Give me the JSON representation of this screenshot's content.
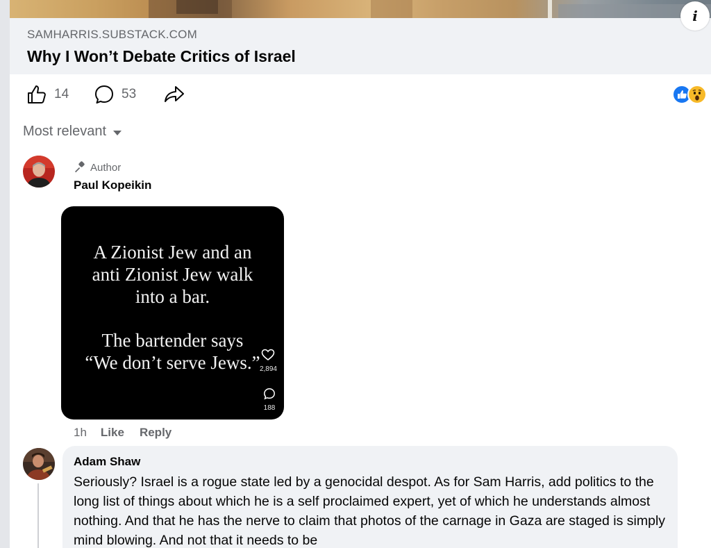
{
  "link_preview": {
    "domain": "SAMHARRIS.SUBSTACK.COM",
    "title": "Why I Won’t Debate Critics of Israel"
  },
  "post_actions": {
    "likes_count": "14",
    "comments_count": "53"
  },
  "reactions": [
    "like",
    "wow"
  ],
  "comments_sort": {
    "label": "Most relevant"
  },
  "comments": [
    {
      "badge": "Author",
      "name": "Paul Kopeikin",
      "meme": {
        "lines_top": [
          "A Zionist Jew and an",
          "anti Zionist Jew walk",
          "into a bar."
        ],
        "lines_bottom": [
          "The bartender says",
          "“We don’t serve Jews.”"
        ],
        "like_count": "2,894",
        "comment_count": "188"
      },
      "time": "1h",
      "like_label": "Like",
      "reply_label": "Reply"
    },
    {
      "name": "Adam Shaw",
      "text": "Seriously? Israel is a rogue state led by a genocidal despot. As for Sam Harris, add politics to the long list of things about which he is a self proclaimed expert, yet of which he understands almost nothing. And that he has the nerve to claim that photos of the carnage in Gaza are staged is simply mind blowing. And not that it needs to be"
    }
  ],
  "colors": {
    "secondary_text": "#65676b",
    "card_bg": "#f0f2f5",
    "like_blue": "#1877f2",
    "wow_yellow": "#f7b928"
  }
}
